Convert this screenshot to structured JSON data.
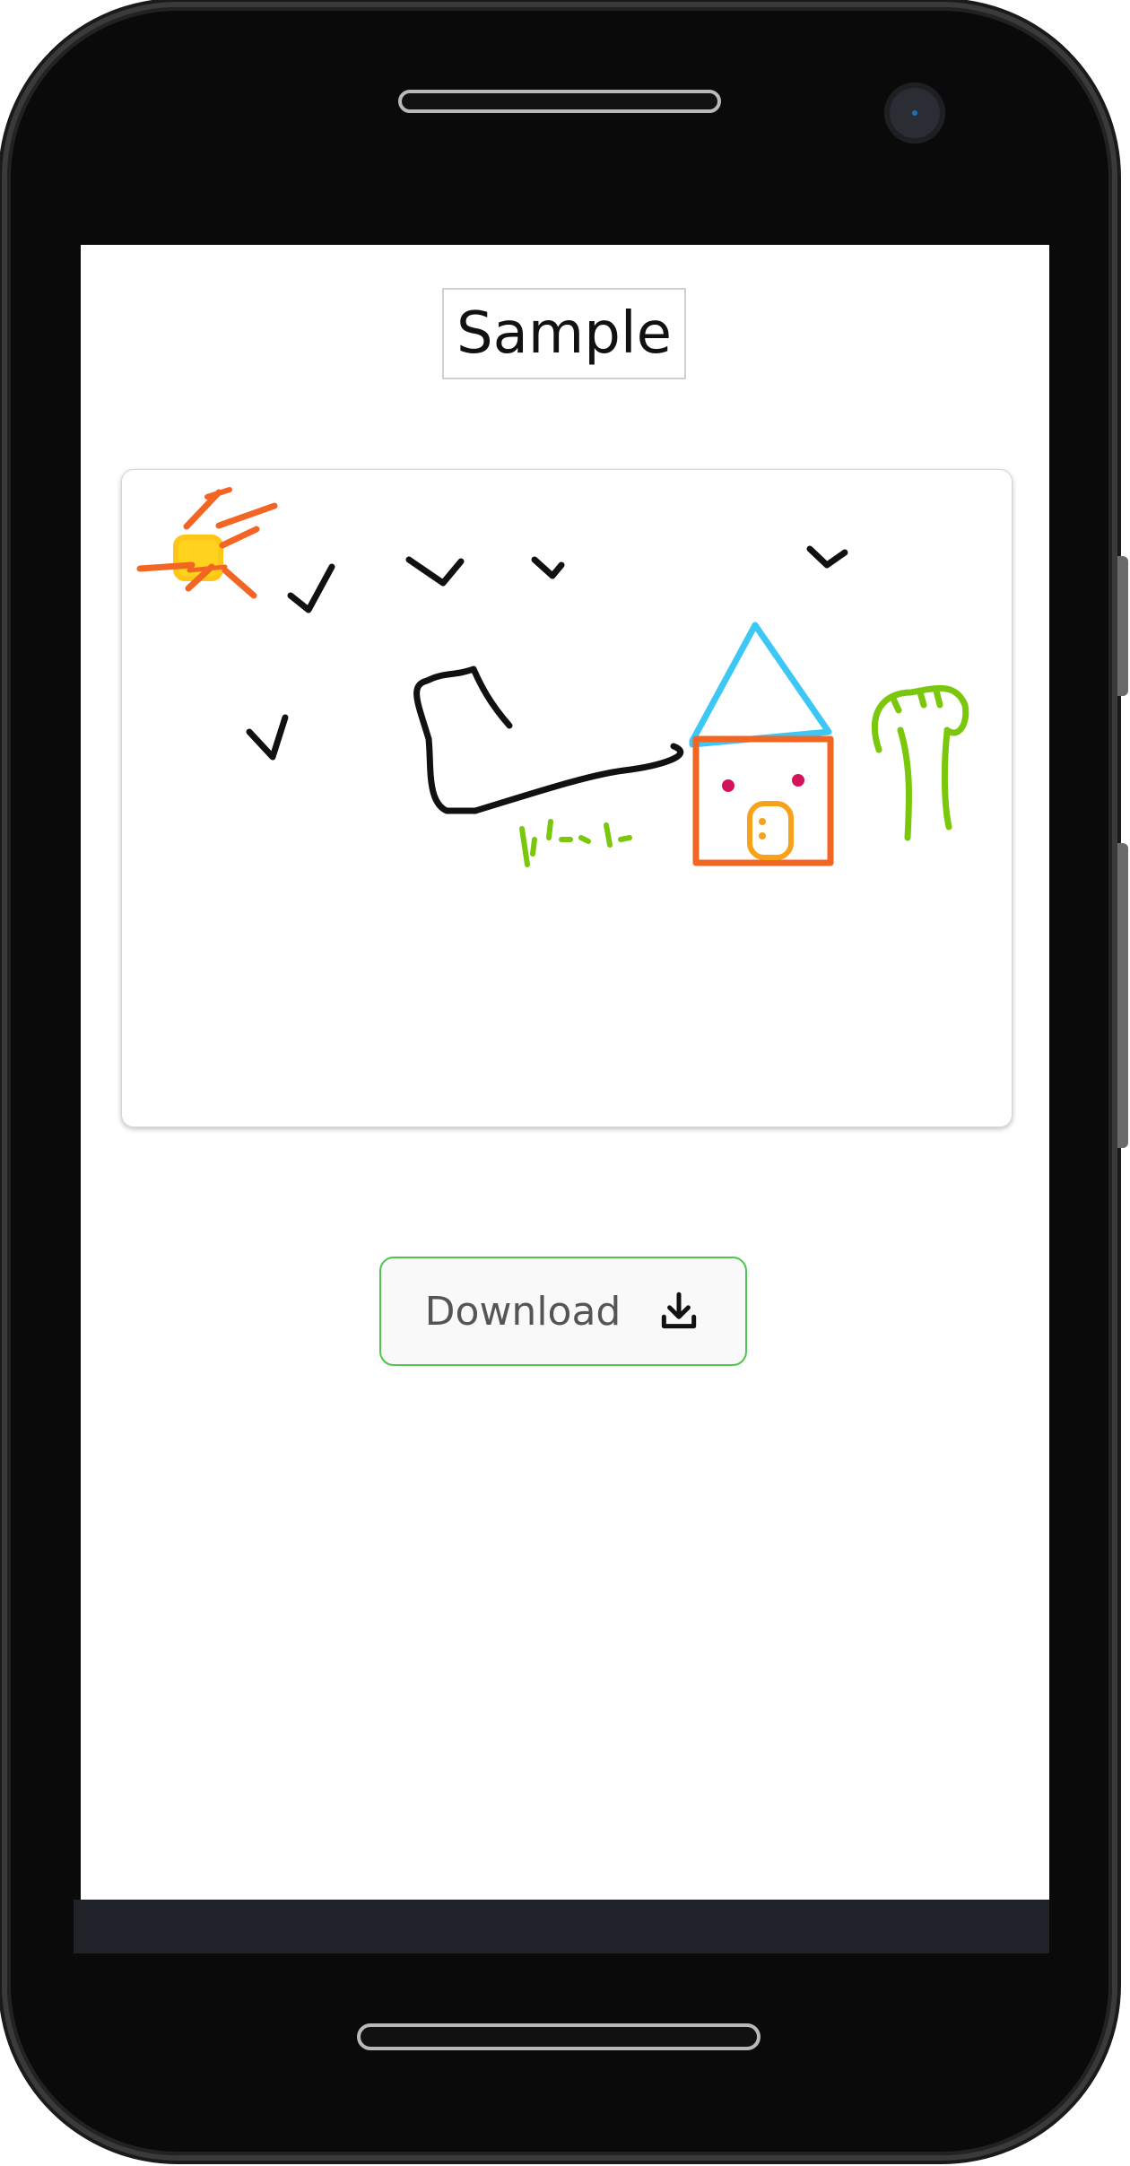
{
  "page": {
    "title": "Sample"
  },
  "canvas": {
    "drawing": "doodle-sketch"
  },
  "actions": {
    "download_label": "Download",
    "download_icon": "download-icon"
  },
  "colors": {
    "button_border": "#4cc64c",
    "sun_orange": "#f26522",
    "sun_yellow": "#ffd21e",
    "roof_blue": "#3cc7f5",
    "house_orange": "#f26522",
    "door_orange": "#f7a21b",
    "window_red": "#d4145a",
    "tree_green": "#7ac70c"
  }
}
